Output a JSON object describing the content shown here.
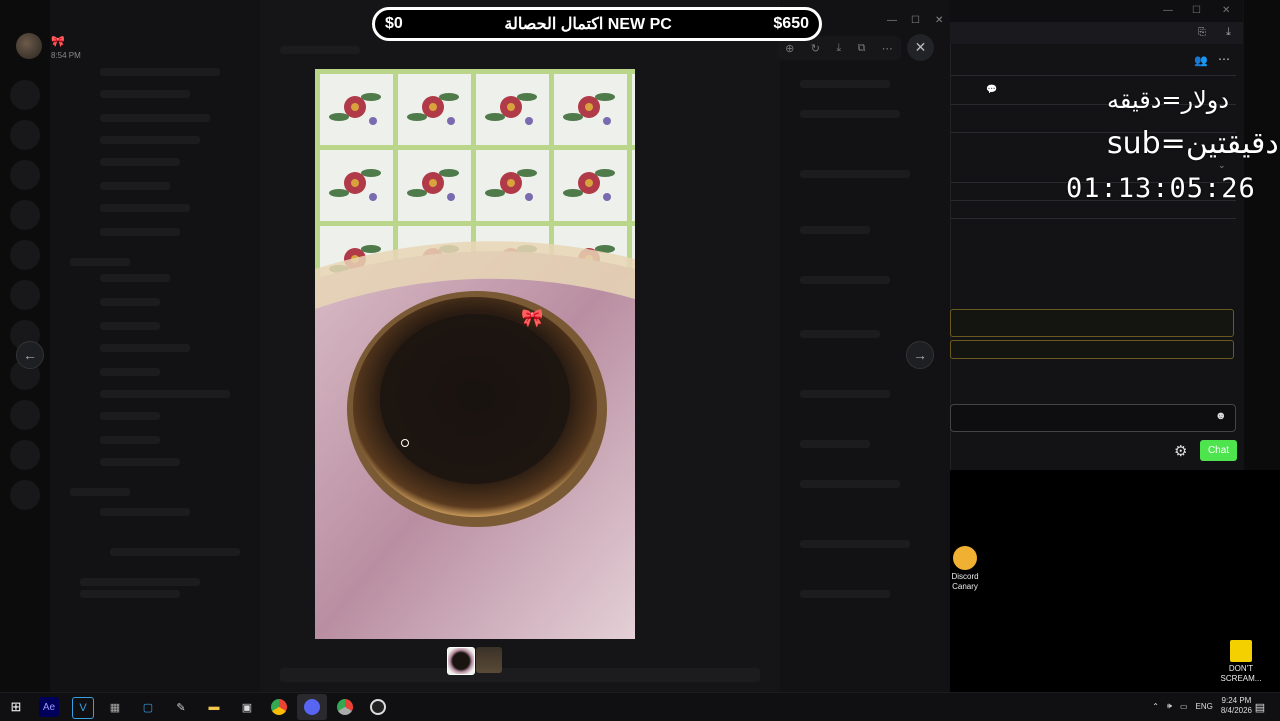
{
  "viewer": {
    "time": "8:54 PM",
    "toolbar_icons": [
      "zoom-icon",
      "rotate-icon",
      "download-icon",
      "open-external-icon",
      "more-icon"
    ],
    "close_glyph": "✕",
    "prev_glyph": "←",
    "next_glyph": "→"
  },
  "goal_bar": {
    "start_amount": "$0",
    "title": "اكتمال الحصالة NEW PC",
    "target_amount": "$650"
  },
  "stream_overlay": {
    "rate_dollar": "دولار=دقيقه",
    "rate_sub": "sub=دقيقتين",
    "timer": "01:13:05:26"
  },
  "stream_chat": {
    "chat_button": "Chat"
  },
  "desktop_icons": [
    {
      "name": "discord-canary",
      "label_line1": "Discord",
      "label_line2": "Canary"
    },
    {
      "name": "dont-scream",
      "label_line1": "DON'T",
      "label_line2": "SCREAM..."
    }
  ],
  "taskbar": {
    "language": "ENG",
    "time": "9:24 PM",
    "date": "8/4/2026"
  },
  "colors": {
    "chat_button": "#4ee44e",
    "goal_border": "#ffffff",
    "bow_pink": "#e84f9a"
  }
}
